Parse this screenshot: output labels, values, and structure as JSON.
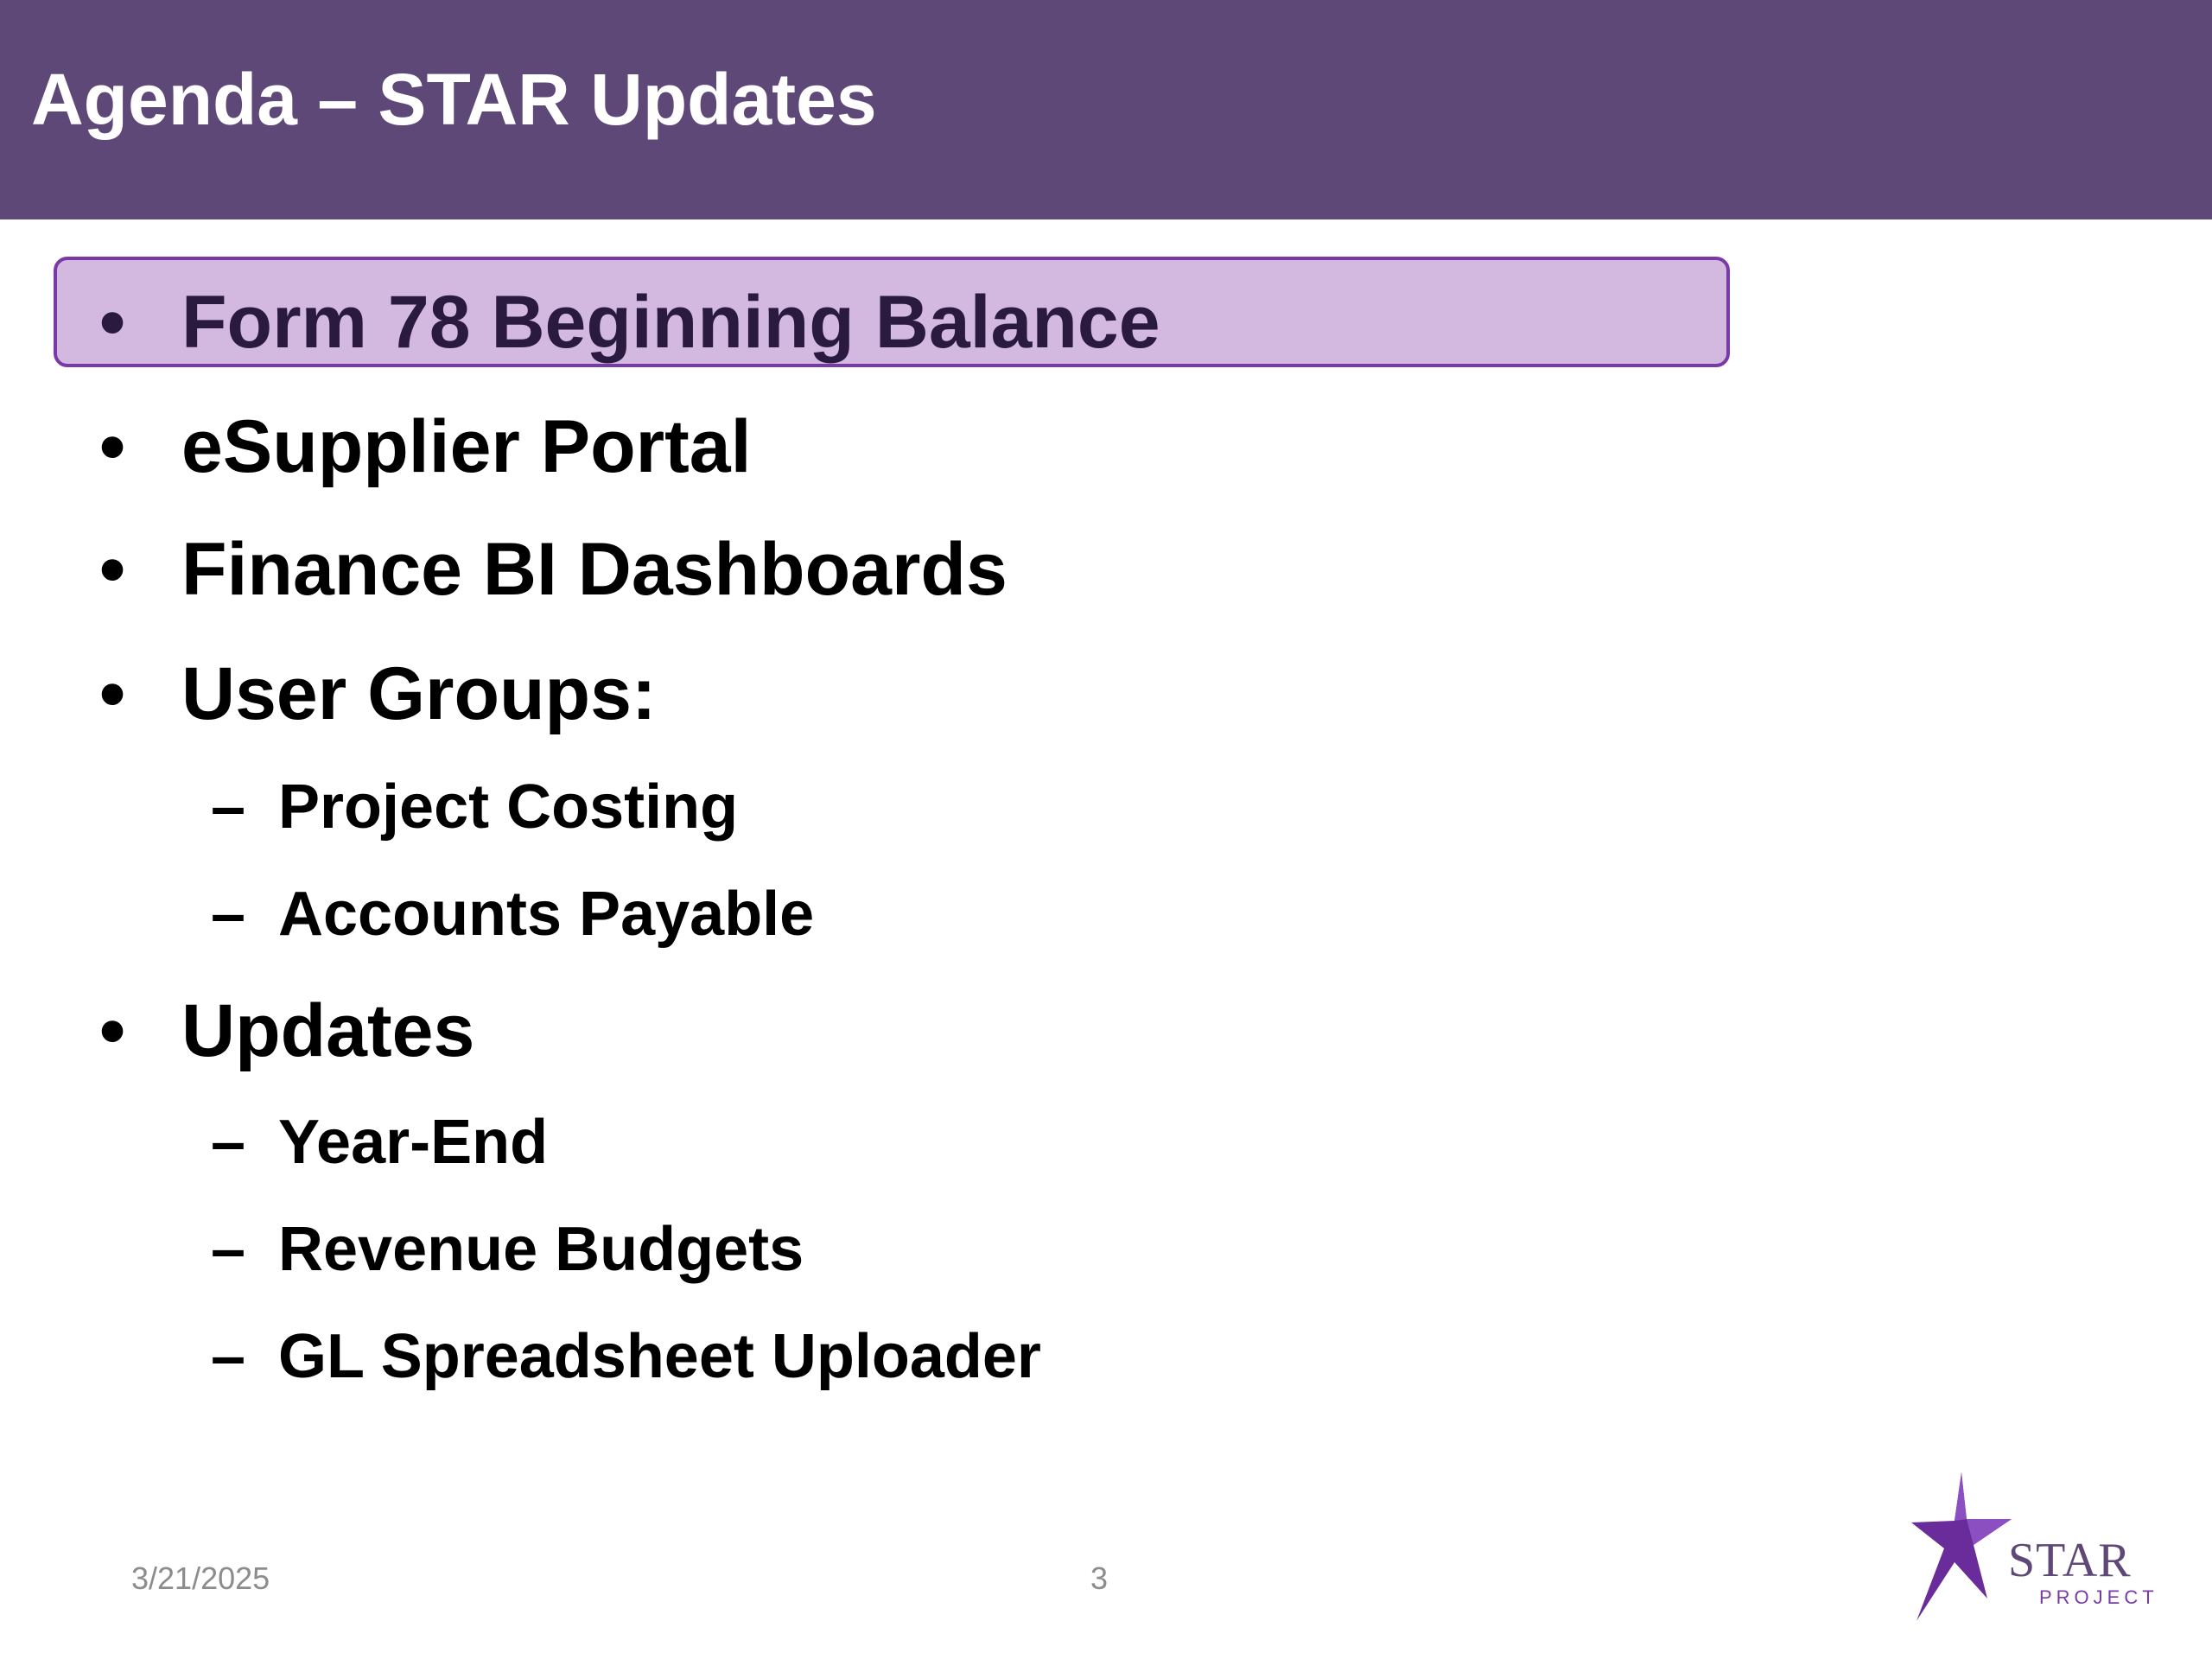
{
  "slide": {
    "title": "Agenda – STAR Updates",
    "footer_date": "3/21/2025",
    "page_number": "3",
    "logo": {
      "word": "STAR",
      "sub": "PROJECT"
    }
  },
  "agenda": {
    "items": [
      {
        "marker": "•",
        "text": "Form 78 Beginning Balance"
      },
      {
        "marker": "•",
        "text": "eSupplier Portal"
      },
      {
        "marker": "•",
        "text": "Finance BI Dashboards"
      },
      {
        "marker": "•",
        "text": "User Groups:"
      },
      {
        "marker": "–",
        "text": "Project Costing"
      },
      {
        "marker": "–",
        "text": "Accounts Payable"
      },
      {
        "marker": "•",
        "text": "Updates"
      },
      {
        "marker": "–",
        "text": "Year-End"
      },
      {
        "marker": "–",
        "text": "Revenue Budgets"
      },
      {
        "marker": "–",
        "text": "GL Spreadsheet Uploader"
      }
    ]
  },
  "colors": {
    "title_bar": "#5e4878",
    "highlight_fill": "#d3b9e0",
    "highlight_border": "#7a3aa6"
  }
}
